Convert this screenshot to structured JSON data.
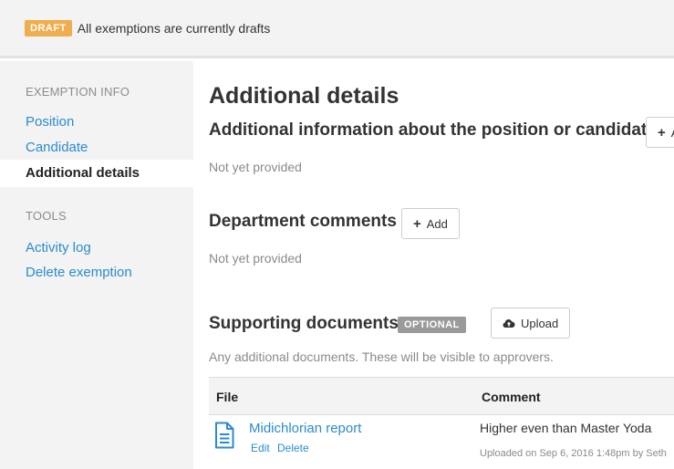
{
  "banner": {
    "badge": "DRAFT",
    "message": "All exemptions are currently drafts"
  },
  "sidebar": {
    "exemption_info_label": "EXEMPTION INFO",
    "nav_items": [
      {
        "label": "Position"
      },
      {
        "label": "Candidate"
      },
      {
        "label": "Additional details"
      }
    ],
    "tools_label": "TOOLS",
    "tool_items": [
      {
        "label": "Activity log"
      },
      {
        "label": "Delete exemption"
      }
    ]
  },
  "main": {
    "title": "Additional details",
    "additional_info": {
      "heading": "Additional information about the position or candidate",
      "button_label": "A",
      "status": "Not yet provided"
    },
    "department_comments": {
      "heading": "Department comments",
      "button_label": "Add",
      "status": "Not yet provided"
    },
    "supporting_documents": {
      "heading": "Supporting documents",
      "badge": "OPTIONAL",
      "button_label": "Upload",
      "description": "Any additional documents. These will be visible to approvers.",
      "table": {
        "columns": [
          "File",
          "Comment"
        ],
        "rows": [
          {
            "file_name": "Midichlorian report",
            "edit_label": "Edit",
            "delete_label": "Delete",
            "comment": "Higher even than Master Yoda",
            "uploaded": "Uploaded on Sep 6, 2016 1:48pm by Seth"
          }
        ]
      }
    }
  },
  "colors": {
    "link": "#2a8bd2",
    "draft_badge": "#f0ad4e",
    "optional_badge": "#9a9a9a",
    "sidebar_bg": "#f3f3f3"
  }
}
